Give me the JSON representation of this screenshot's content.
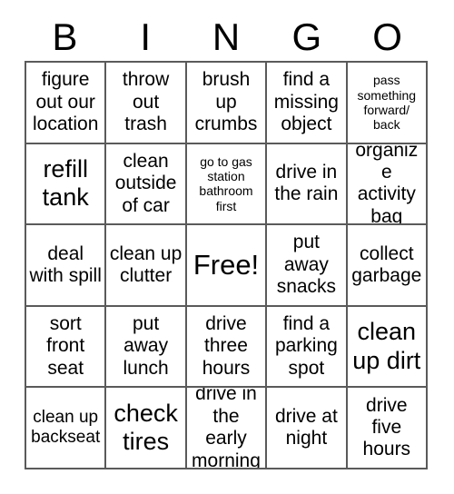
{
  "header": {
    "letters": [
      "B",
      "I",
      "N",
      "G",
      "O"
    ]
  },
  "grid": {
    "rows": 5,
    "columns": 5,
    "border_color": "#5a5a5a",
    "background_color": "#ffffff",
    "text_color": "#000000",
    "cells": [
      {
        "text": "figure out our location",
        "size": "md"
      },
      {
        "text": "throw out trash",
        "size": "md"
      },
      {
        "text": "brush up crumbs",
        "size": "md"
      },
      {
        "text": "find a missing object",
        "size": "md"
      },
      {
        "text": "pass something forward/ back",
        "size": "xs"
      },
      {
        "text": "refill tank",
        "size": "lg"
      },
      {
        "text": "clean outside of car",
        "size": "md"
      },
      {
        "text": "go to gas station bathroom first",
        "size": "xs"
      },
      {
        "text": "drive in the rain",
        "size": "md"
      },
      {
        "text": "organize activity bag",
        "size": "md"
      },
      {
        "text": "deal with spill",
        "size": "md"
      },
      {
        "text": "clean up clutter",
        "size": "md"
      },
      {
        "text": "Free!",
        "size": "xl"
      },
      {
        "text": "put away snacks",
        "size": "md"
      },
      {
        "text": "collect garbage",
        "size": "md"
      },
      {
        "text": "sort front seat",
        "size": "md"
      },
      {
        "text": "put away lunch",
        "size": "md"
      },
      {
        "text": "drive three hours",
        "size": "md"
      },
      {
        "text": "find a parking spot",
        "size": "md"
      },
      {
        "text": "clean up dirt",
        "size": "lg"
      },
      {
        "text": "clean up backseat",
        "size": "sm"
      },
      {
        "text": "check tires",
        "size": "lg"
      },
      {
        "text": "drive in the early morning",
        "size": "md"
      },
      {
        "text": "drive at night",
        "size": "md"
      },
      {
        "text": "drive five hours",
        "size": "md"
      }
    ]
  }
}
